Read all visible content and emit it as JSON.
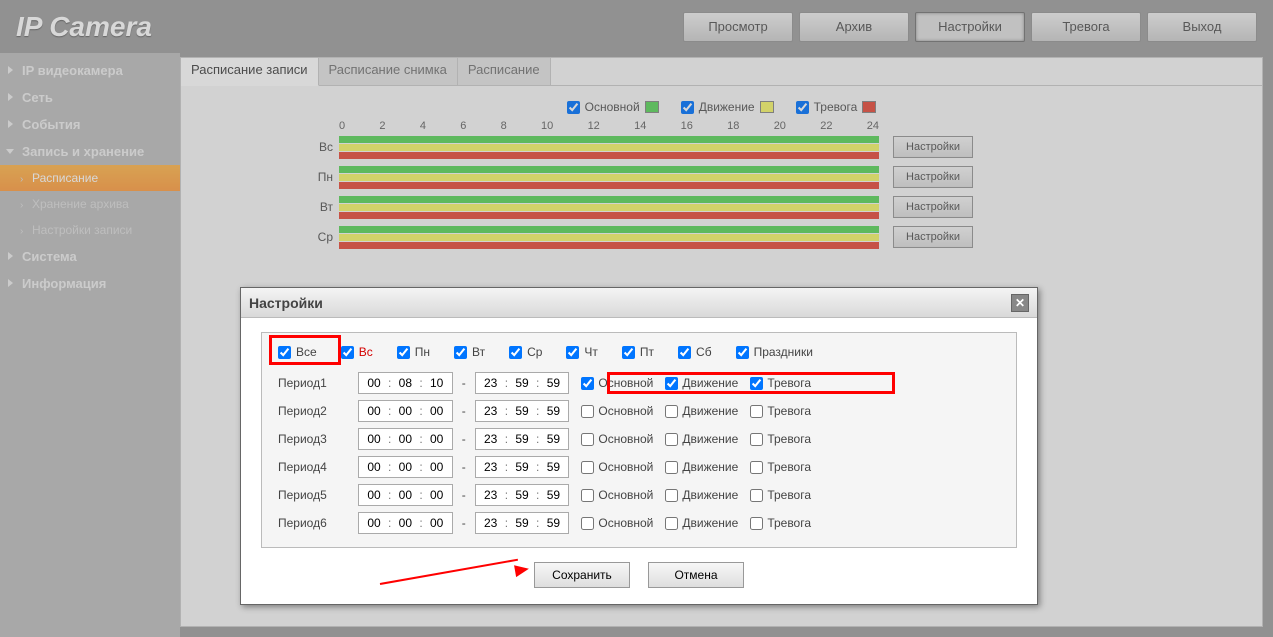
{
  "logo": "IP Camera",
  "nav": {
    "view": "Просмотр",
    "archive": "Архив",
    "settings": "Настройки",
    "alarm": "Тревога",
    "exit": "Выход"
  },
  "sidebar": {
    "camera": "IP видеокамера",
    "network": "Сеть",
    "events": "События",
    "storage": "Запись и хранение",
    "schedule": "Расписание",
    "archive_storage": "Хранение архива",
    "record_settings": "Настройки записи",
    "system": "Система",
    "info": "Информация"
  },
  "tabs": {
    "record_schedule": "Расписание записи",
    "snapshot_schedule": "Расписание снимка",
    "schedule": "Расписание"
  },
  "legend": {
    "main": "Основной",
    "motion": "Движение",
    "alarm": "Тревога"
  },
  "ticks": [
    "0",
    "2",
    "4",
    "6",
    "8",
    "10",
    "12",
    "14",
    "16",
    "18",
    "20",
    "22",
    "24"
  ],
  "days": [
    {
      "label": "Вс",
      "btn": "Настройки"
    },
    {
      "label": "Пн",
      "btn": "Настройки"
    },
    {
      "label": "Вт",
      "btn": "Настройки"
    },
    {
      "label": "Ср",
      "btn": "Настройки"
    }
  ],
  "dialog": {
    "title": "Настройки",
    "days": {
      "all": "Все",
      "sun": "Вс",
      "mon": "Пн",
      "tue": "Вт",
      "wed": "Ср",
      "thu": "Чт",
      "fri": "Пт",
      "sat": "Сб",
      "holidays": "Праздники"
    },
    "periods": [
      {
        "label": "Период1",
        "h1": "00",
        "m1": "08",
        "s1": "10",
        "h2": "23",
        "m2": "59",
        "s2": "59",
        "main": true,
        "motion": true,
        "alarm": true
      },
      {
        "label": "Период2",
        "h1": "00",
        "m1": "00",
        "s1": "00",
        "h2": "23",
        "m2": "59",
        "s2": "59",
        "main": false,
        "motion": false,
        "alarm": false
      },
      {
        "label": "Период3",
        "h1": "00",
        "m1": "00",
        "s1": "00",
        "h2": "23",
        "m2": "59",
        "s2": "59",
        "main": false,
        "motion": false,
        "alarm": false
      },
      {
        "label": "Период4",
        "h1": "00",
        "m1": "00",
        "s1": "00",
        "h2": "23",
        "m2": "59",
        "s2": "59",
        "main": false,
        "motion": false,
        "alarm": false
      },
      {
        "label": "Период5",
        "h1": "00",
        "m1": "00",
        "s1": "00",
        "h2": "23",
        "m2": "59",
        "s2": "59",
        "main": false,
        "motion": false,
        "alarm": false
      },
      {
        "label": "Период6",
        "h1": "00",
        "m1": "00",
        "s1": "00",
        "h2": "23",
        "m2": "59",
        "s2": "59",
        "main": false,
        "motion": false,
        "alarm": false
      }
    ],
    "chk_main": "Основной",
    "chk_motion": "Движение",
    "chk_alarm": "Тревога",
    "save": "Сохранить",
    "cancel": "Отмена"
  }
}
